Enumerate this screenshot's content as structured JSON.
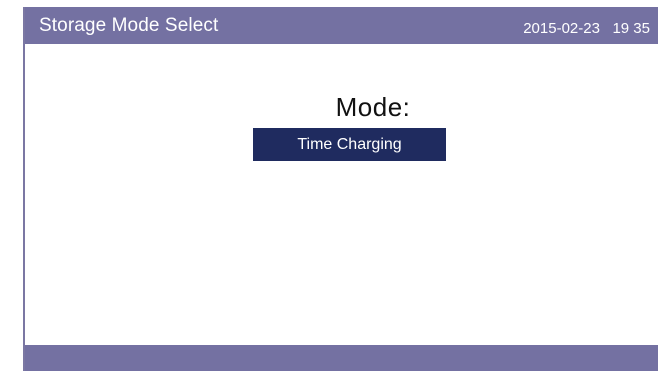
{
  "header": {
    "title": "Storage Mode Select",
    "datetime": "2015-02-23   19 35"
  },
  "main": {
    "mode_label": "Mode:",
    "mode_value": "Time Charging"
  },
  "colors": {
    "header_bg": "#7471a2",
    "selection_bg": "#1f2b5f",
    "footer_bg": "#7471a2"
  }
}
